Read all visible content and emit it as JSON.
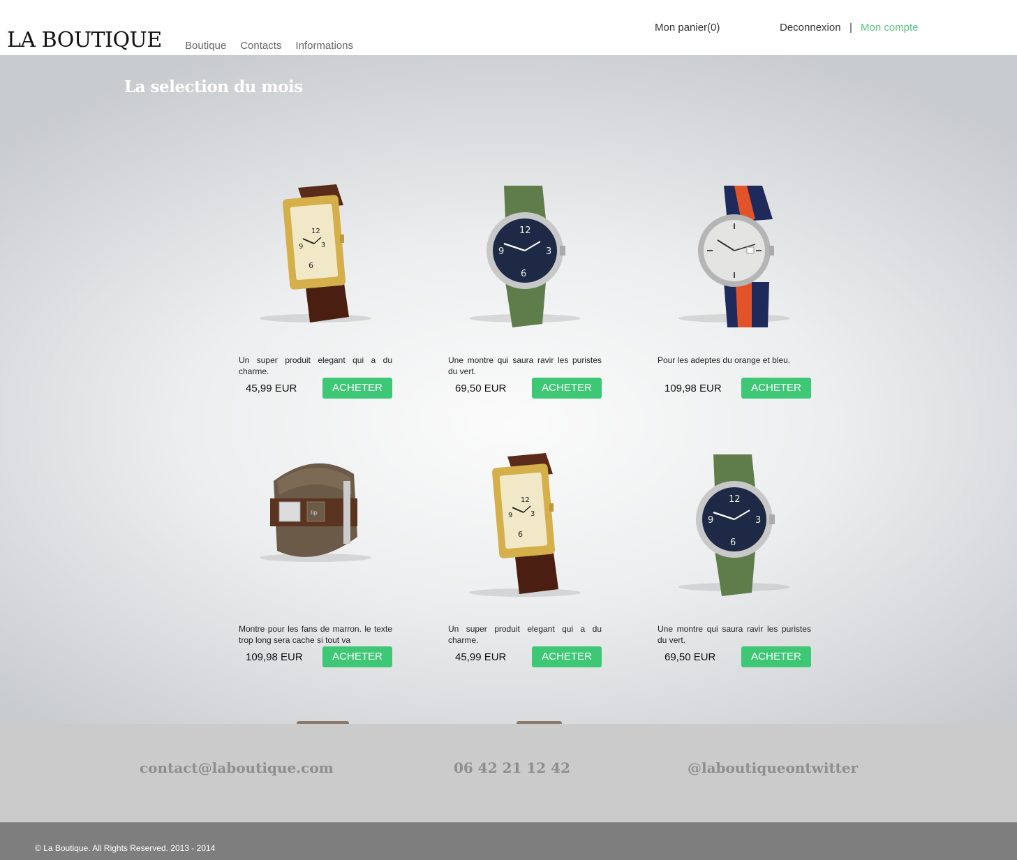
{
  "header": {
    "logo": "LA BOUTIQUE",
    "nav": [
      "Boutique",
      "Contacts",
      "Informations"
    ],
    "cart": "Mon panier(0)",
    "logout": "Deconnexion",
    "separator": "|",
    "account": "Mon compte",
    "accent_color": "#58c67d"
  },
  "main": {
    "title": "La selection du mois",
    "button_color": "#3ec775",
    "products": [
      {
        "desc": "Un super produit elegant qui a du charme.",
        "price": "45,99 EUR",
        "button": "ACHETER",
        "image": "gold-rectangular-watch-brown-strap-icon"
      },
      {
        "desc": "Une montre qui saura ravir les puristes du vert.",
        "price": "69,50 EUR",
        "button": "ACHETER",
        "image": "green-nato-strap-watch-icon"
      },
      {
        "desc": "Pour les adeptes du orange et bleu.",
        "price": "109,98 EUR",
        "button": "ACHETER",
        "image": "orange-blue-strap-watch-icon"
      },
      {
        "desc": "Montre pour les fans de marron. le texte trop long sera cache si tout va",
        "price": "109,98 EUR",
        "button": "ACHETER",
        "image": "brown-cuff-watch-icon"
      },
      {
        "desc": "Un super produit elegant qui a du charme.",
        "price": "45,99 EUR",
        "button": "ACHETER",
        "image": "gold-rectangular-watch-brown-strap-icon"
      },
      {
        "desc": "Une montre qui saura ravir les puristes du vert.",
        "price": "69,50 EUR",
        "button": "ACHETER",
        "image": "green-nato-strap-watch-icon"
      }
    ]
  },
  "footer": {
    "email": "contact@laboutique.com",
    "phone": "06 42 21 12 42",
    "twitter": "@laboutiqueontwitter",
    "copyright": "© La Boutique. All Rights Reserved. 2013 - 2014"
  }
}
